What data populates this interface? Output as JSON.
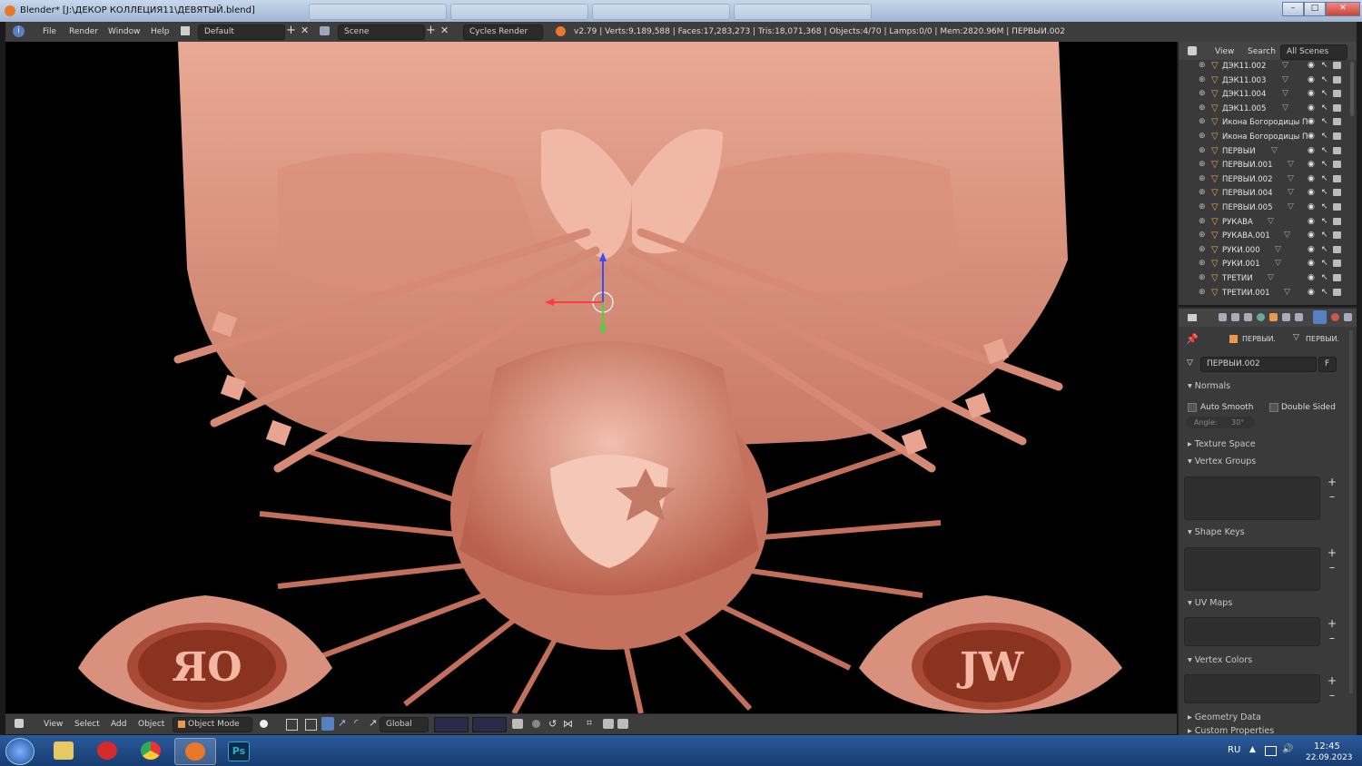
{
  "window": {
    "title": "Blender* [J:\\ДЕКОР КОЛЛЕЦИЯ11\\ДЕВЯТЫЙ.blend]",
    "buttons": [
      "–",
      "□",
      "✕"
    ]
  },
  "menu": [
    "File",
    "Render",
    "Window",
    "Help"
  ],
  "layout_field": "Default",
  "scene_field": "Scene",
  "render_engine": "Cycles Render",
  "stats": "v2.79 | Verts:9,189,588 | Faces:17,283,273 | Tris:18,071,368 | Objects:4/70 | Lamps:0/0 | Mem:2820.96M | ПЕРВЫИ.002",
  "viewport_header": {
    "items": [
      "View",
      "Select",
      "Add",
      "Object"
    ],
    "mode": "Object Mode",
    "orientation": "Global"
  },
  "viewport_art": {
    "left_medallion": "ЯO",
    "right_medallion": "JW"
  },
  "outliner": {
    "tabs": [
      "View",
      "Search",
      "All Scenes"
    ],
    "rows": [
      "ДЭК11.002",
      "ДЭК11.003",
      "ДЭК11.004",
      "ДЭК11.005",
      "Икона Богородицы П",
      "Икона Богородицы П",
      "ПЕРВЫИ",
      "ПЕРВЫИ.001",
      "ПЕРВЫИ.002",
      "ПЕРВЫИ.004",
      "ПЕРВЫИ.005",
      "РУКАВА",
      "РУКАВА.001",
      "РУКИ.000",
      "РУКИ.001",
      "ТРЕТИИ",
      "ТРЕТИИ.001"
    ]
  },
  "properties": {
    "breadcrumb_object": "ПЕРВЫИ.",
    "breadcrumb_mesh": "ПЕРВЫИ.",
    "mesh_name": "ПЕРВЫИ.002",
    "mesh_flag": "F",
    "panels": {
      "normals": "Normals",
      "auto_smooth": "Auto Smooth",
      "double_sided": "Double Sided",
      "angle_label": "Angle:",
      "angle_value": "30°",
      "texture_space": "Texture Space",
      "vertex_groups": "Vertex Groups",
      "shape_keys": "Shape Keys",
      "uv_maps": "UV Maps",
      "vertex_colors": "Vertex Colors",
      "geometry_data": "Geometry Data",
      "custom_properties": "Custom Properties"
    }
  },
  "taskbar": {
    "lang": "RU",
    "time": "12:45",
    "date": "22.09.2023",
    "ps_label": "Ps"
  },
  "colors": {
    "model": "#d98a78",
    "model_dark": "#8e3a2a",
    "panel_bg": "#3a3a3a",
    "header_bg": "#3d3d3d",
    "accent_orange": "#f0a040"
  }
}
